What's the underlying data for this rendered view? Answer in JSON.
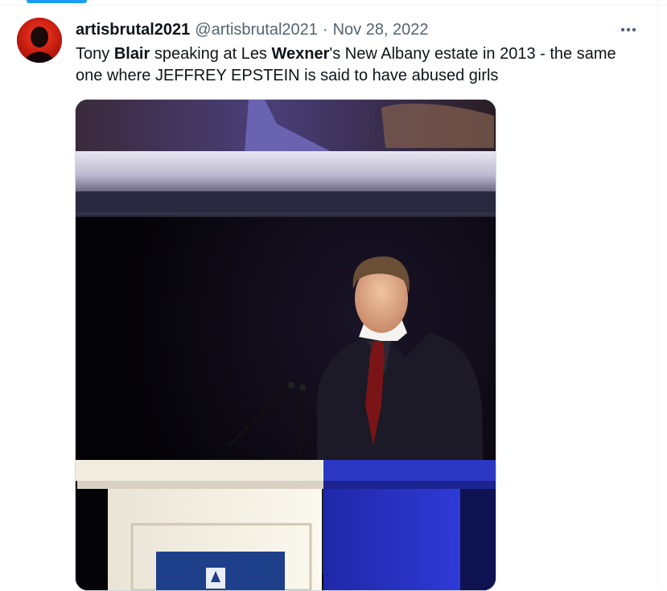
{
  "tweet": {
    "display_name": "artisbrutal2021",
    "handle": "@artisbrutal2021",
    "separator": "·",
    "date": "Nov 28, 2022",
    "text_parts": [
      "Tony ",
      "Blair",
      " speaking at Les ",
      "Wexner",
      "'s New Albany estate in 2013 - the same one where JEFFREY EPSTEIN is said to have abused girls"
    ]
  },
  "icons": {
    "more": "more-horizontal-icon",
    "avatar": "avatar"
  },
  "colors": {
    "accent": "#1d9bf0",
    "text_primary": "#0f1419",
    "text_secondary": "#536471",
    "border": "#cfd9de"
  }
}
